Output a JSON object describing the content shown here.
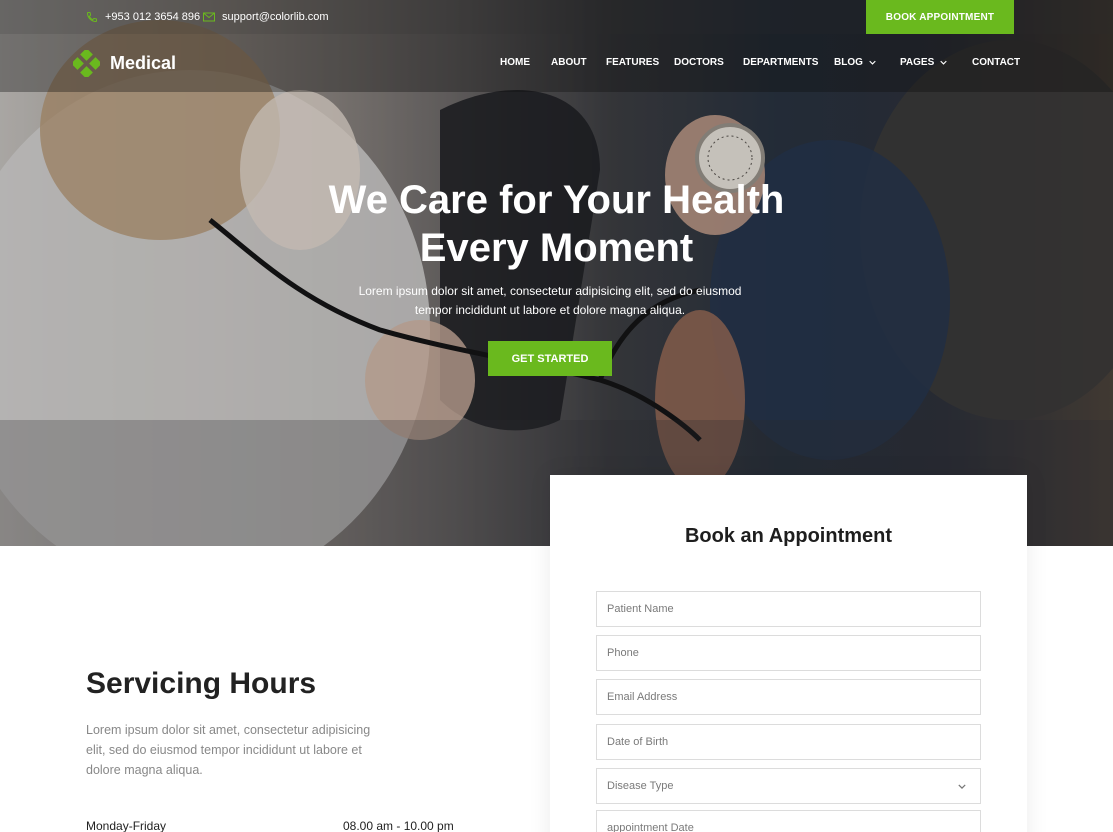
{
  "topbar": {
    "phone": "+953 012 3654 896",
    "email": "support@colorlib.com",
    "book_button": "BOOK APPOINTMENT"
  },
  "navbar": {
    "logo_text": "Medical",
    "items": [
      {
        "label": "HOME"
      },
      {
        "label": "ABOUT"
      },
      {
        "label": "FEATURES"
      },
      {
        "label": "DOCTORS"
      },
      {
        "label": "DEPARTMENTS"
      },
      {
        "label": "BLOG"
      },
      {
        "label": "PAGES"
      },
      {
        "label": "CONTACT"
      }
    ]
  },
  "hero": {
    "title_line1": "We Care for Your Health",
    "title_line2": "Every Moment",
    "subtitle_line1": "Lorem ipsum dolor sit amet, consectetur adipisicing elit, sed do eiusmod",
    "subtitle_line2": "tempor incididunt ut labore et dolore magna aliqua.",
    "cta": "GET STARTED"
  },
  "servicing": {
    "title": "Servicing Hours",
    "text_line1": "Lorem ipsum dolor sit amet, consectetur adipisicing",
    "text_line2": "elit, sed do eiusmod tempor incididunt ut labore et",
    "text_line3": "dolore magna aliqua.",
    "hours": [
      {
        "day": "Monday-Friday",
        "time": "08.00 am - 10.00 pm"
      }
    ]
  },
  "appointment": {
    "title": "Book an Appointment",
    "fields": {
      "patient_name": "Patient Name",
      "phone": "Phone",
      "email": "Email Address",
      "dob": "Date of Birth",
      "disease": "Disease Type",
      "date": "appointment Date"
    }
  },
  "colors": {
    "accent": "#6ab91e",
    "dark_text": "#222222",
    "muted_text": "#888888"
  }
}
